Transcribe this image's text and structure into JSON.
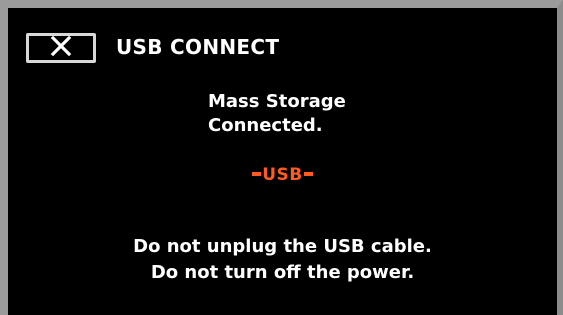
{
  "header": {
    "close_icon": "close-icon",
    "title": "USB CONNECT"
  },
  "status": {
    "line1": "Mass Storage",
    "line2": "Connected."
  },
  "usb_label": "USB",
  "warning": {
    "line1": "Do not unplug the USB cable.",
    "line2": "Do not turn off the power."
  },
  "colors": {
    "background": "#000000",
    "text": "#ffffff",
    "accent": "#ff5a1f",
    "frame": "#9b9b9b"
  }
}
